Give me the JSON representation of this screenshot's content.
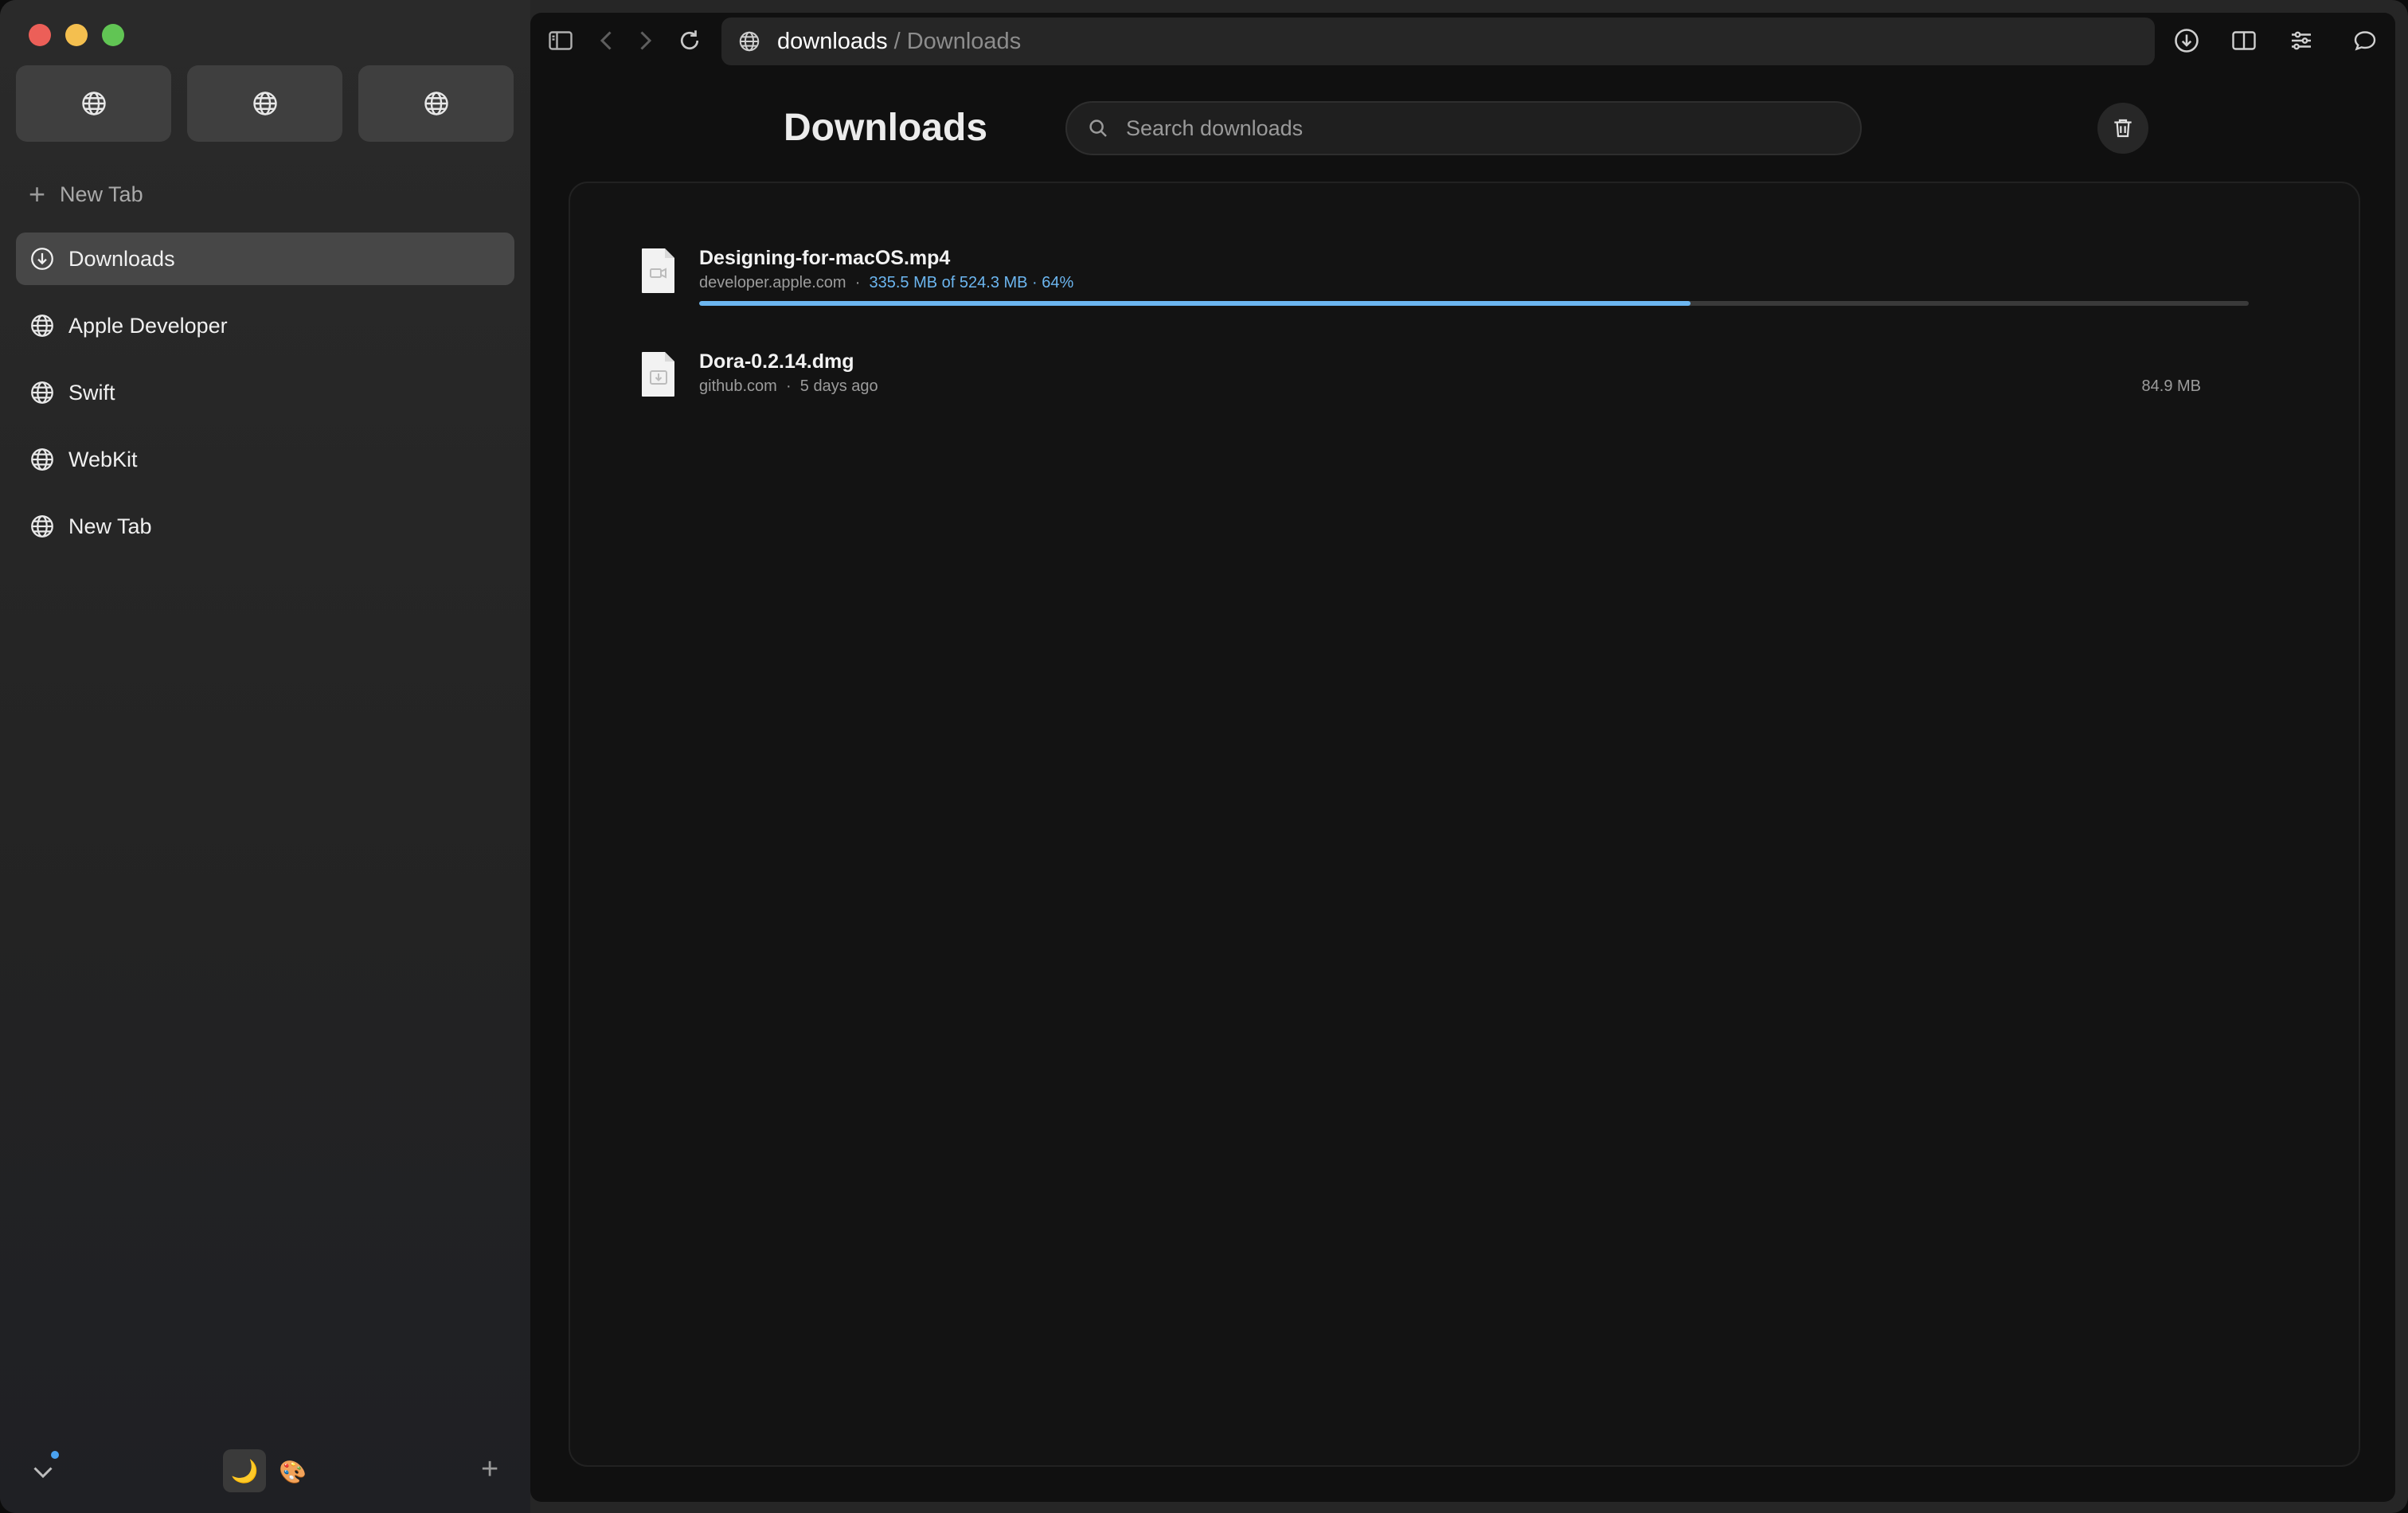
{
  "sidebar": {
    "pinned": [
      {
        "icon": "globe-icon"
      },
      {
        "icon": "globe-icon"
      },
      {
        "icon": "globe-icon"
      }
    ],
    "new_tab_label": "New Tab",
    "tabs": [
      {
        "label": "Downloads",
        "icon": "download-circle-icon",
        "active": true
      },
      {
        "label": "Apple Developer",
        "icon": "globe-icon"
      },
      {
        "label": "Swift",
        "icon": "globe-icon"
      },
      {
        "label": "WebKit",
        "icon": "globe-icon"
      },
      {
        "label": "New Tab",
        "icon": "globe-icon"
      }
    ],
    "footer": {
      "moon_glyph": "🌙",
      "palette_glyph": "🎨",
      "plus_glyph": "+"
    }
  },
  "toolbar": {
    "url_host": "downloads",
    "url_separator": "/",
    "url_page": "Downloads"
  },
  "downloads": {
    "title": "Downloads",
    "search_placeholder": "Search downloads",
    "items": [
      {
        "name": "Designing-for-macOS.mp4",
        "source": "developer.apple.com",
        "dot": "·",
        "progress_text": "335.5 MB of 524.3 MB · 64%",
        "progress": 0.64,
        "icon": "video-file-icon"
      },
      {
        "name": "Dora-0.2.14.dmg",
        "source": "github.com",
        "dot": "·",
        "age": "5 days ago",
        "size": "84.9 MB",
        "icon": "disk-image-file-icon"
      }
    ]
  },
  "colors": {
    "accent": "#6cb6f0",
    "close": "#ec5f58",
    "minimize": "#f4bf4f",
    "maximize": "#61c554"
  }
}
